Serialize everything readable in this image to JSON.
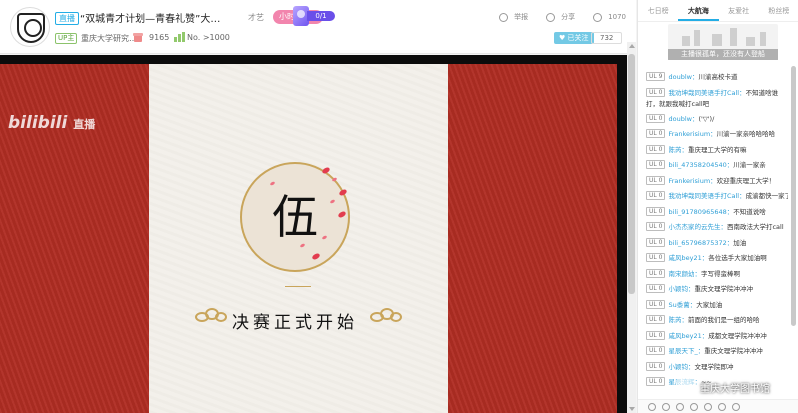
{
  "header": {
    "live_tag": "直播",
    "title": "“双城青才计划—青春礼赞”大学…",
    "category": "才艺",
    "hour_rank": "小时总榜 ›",
    "pk_progress": "0/1",
    "up_tag": "UP主",
    "up_name": "重庆大学研究…",
    "gift_count": "9165",
    "rank": "No. >1000",
    "report": "举报",
    "share": "分享",
    "viewers": "1070",
    "follow_label": "♥ 已关注",
    "follow_count": "732"
  },
  "player": {
    "logo_text": "bilibili",
    "logo_small": "直播",
    "emblem_char": "伍",
    "final_title": "决赛正式开始"
  },
  "sidebar": {
    "tabs": [
      "七日榜",
      "大航海",
      "友爱社",
      "粉丝榜"
    ],
    "guard_text": "主播很孤单，还没有人登船"
  },
  "danmaku": [
    {
      "lv": "UL 9",
      "name": "doublw",
      "text": "川渝高校卡道"
    },
    {
      "lv": "UL 0",
      "name": "我劝坤哉同美语手打Call",
      "text": "不知道啥谁打，就跟我喊打call吧"
    },
    {
      "lv": "UL 0",
      "name": "doublw",
      "text": "('▽')/"
    },
    {
      "lv": "UL 0",
      "name": "Frankerisium",
      "text": "川渝一家亲哈哈哈哈"
    },
    {
      "lv": "UL 0",
      "name": "陈芮",
      "text": "重庆理工大学的有嘛"
    },
    {
      "lv": "UL 0",
      "name": "bili_47358204540",
      "text": "川渝一家亲"
    },
    {
      "lv": "UL 0",
      "name": "Frankerisium",
      "text": "欢迎重庆理工大学！"
    },
    {
      "lv": "UL 0",
      "name": "我劝坤哉同美语手打Call",
      "text": "成渝都快一家了"
    },
    {
      "lv": "UL 0",
      "name": "bili_91780965648",
      "text": "不知道说啥"
    },
    {
      "lv": "UL 0",
      "name": "小杰杰家的云先生",
      "text": "西南政法大学打call"
    },
    {
      "lv": "UL 0",
      "name": "bili_65796875372",
      "text": "加油"
    },
    {
      "lv": "UL 0",
      "name": "咸风bey21",
      "text": "各位选手大家加油啊"
    },
    {
      "lv": "UL 0",
      "name": "南宋颜幼",
      "text": "字写得蛮棒啊"
    },
    {
      "lv": "UL 0",
      "name": "小颖钧",
      "text": "重庆文理学院冲冲冲"
    },
    {
      "lv": "UL 0",
      "name": "Su黍蓠",
      "text": "大家加油"
    },
    {
      "lv": "UL 0",
      "name": "陈芮",
      "text": "前面的我们是一组的哈哈"
    },
    {
      "lv": "UL 0",
      "name": "咸风bey21",
      "text": "成都文理学院冲冲冲"
    },
    {
      "lv": "UL 0",
      "name": "星辰天下_",
      "text": "重庆文理学院冲冲冲"
    },
    {
      "lv": "UL 0",
      "name": "小颖钧",
      "text": "文理学院即冲"
    },
    {
      "lv": "UL 0",
      "name": "星辰流辉",
      "text": "~~"
    }
  ],
  "watermark": "重庆大学图书馆",
  "colors": {
    "accent": "#23ade5",
    "stage_red": "#b02d23",
    "gold": "#c9a55b",
    "rank_pink": "#f285ad",
    "pk_purple": "#6a4fe9"
  }
}
